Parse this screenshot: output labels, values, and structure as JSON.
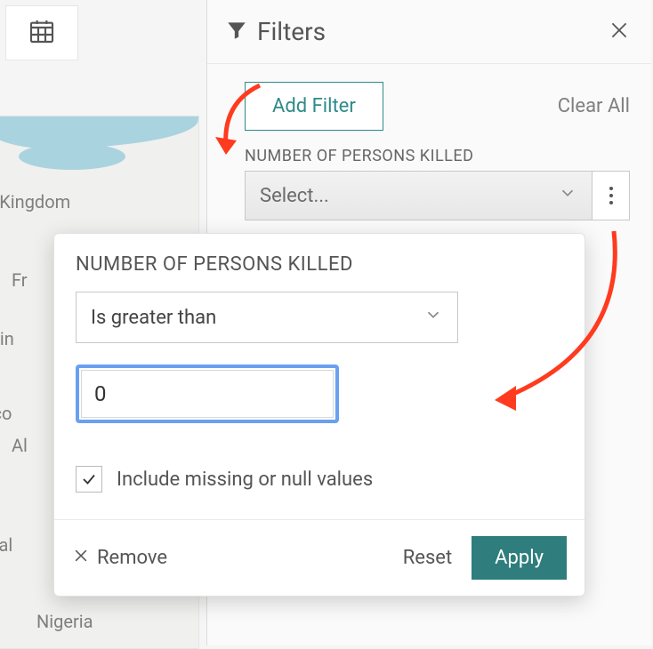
{
  "toolbar": {
    "calendar_icon": "calendar"
  },
  "filters_panel": {
    "title": "Filters",
    "add_filter_label": "Add Filter",
    "clear_all_label": "Clear All",
    "group": {
      "label": "NUMBER OF PERSONS KILLED",
      "select_placeholder": "Select..."
    }
  },
  "popover": {
    "label": "NUMBER OF PERSONS KILLED",
    "operator": "Is greater than",
    "value": "0",
    "include_missing_label": "Include missing or null values",
    "include_missing_checked": true,
    "remove_label": "Remove",
    "reset_label": "Reset",
    "apply_label": "Apply"
  },
  "map": {
    "labels": [
      "d Kingdom",
      "Fr",
      "ain",
      "cco",
      "Al",
      "Mal",
      "Nigeria"
    ]
  }
}
